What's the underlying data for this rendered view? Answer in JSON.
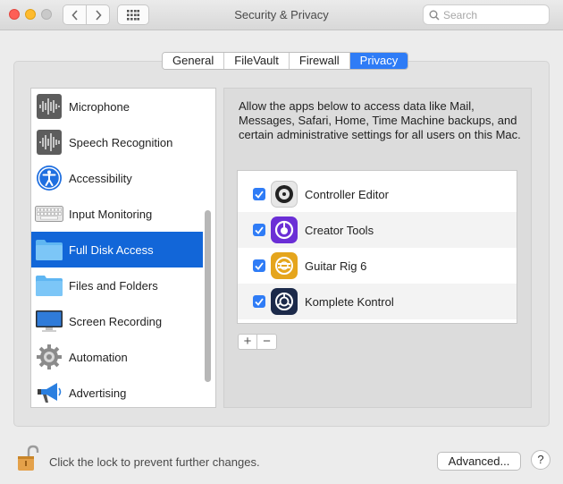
{
  "window": {
    "title": "Security & Privacy",
    "search_placeholder": "Search"
  },
  "tabs": [
    {
      "label": "General",
      "active": false
    },
    {
      "label": "FileVault",
      "active": false
    },
    {
      "label": "Firewall",
      "active": false
    },
    {
      "label": "Privacy",
      "active": true
    }
  ],
  "sidebar": {
    "items": [
      {
        "label": "Microphone",
        "icon": "microphone-waveform-icon",
        "selected": false
      },
      {
        "label": "Speech Recognition",
        "icon": "speech-waveform-icon",
        "selected": false
      },
      {
        "label": "Accessibility",
        "icon": "accessibility-icon",
        "selected": false
      },
      {
        "label": "Input Monitoring",
        "icon": "keyboard-icon",
        "selected": false
      },
      {
        "label": "Full Disk Access",
        "icon": "folder-icon",
        "selected": true
      },
      {
        "label": "Files and Folders",
        "icon": "folder-icon",
        "selected": false
      },
      {
        "label": "Screen Recording",
        "icon": "display-icon",
        "selected": false
      },
      {
        "label": "Automation",
        "icon": "gear-icon",
        "selected": false
      },
      {
        "label": "Advertising",
        "icon": "megaphone-icon",
        "selected": false
      }
    ]
  },
  "main": {
    "description": "Allow the apps below to access data like Mail, Messages, Safari, Home, Time Machine backups, and certain administrative settings for all users on this Mac.",
    "apps": [
      {
        "label": "Controller Editor",
        "checked": true,
        "icon": "controller-editor-icon"
      },
      {
        "label": "Creator Tools",
        "checked": true,
        "icon": "creator-tools-icon"
      },
      {
        "label": "Guitar Rig 6",
        "checked": true,
        "icon": "guitar-rig-icon"
      },
      {
        "label": "Komplete Kontrol",
        "checked": true,
        "icon": "komplete-kontrol-icon"
      }
    ],
    "add_label": "+",
    "remove_label": "−"
  },
  "footer": {
    "lock_text": "Click the lock to prevent further changes.",
    "advanced_label": "Advanced...",
    "help_label": "?"
  },
  "colors": {
    "accent": "#2e7cf6",
    "selection": "#1266d8"
  }
}
